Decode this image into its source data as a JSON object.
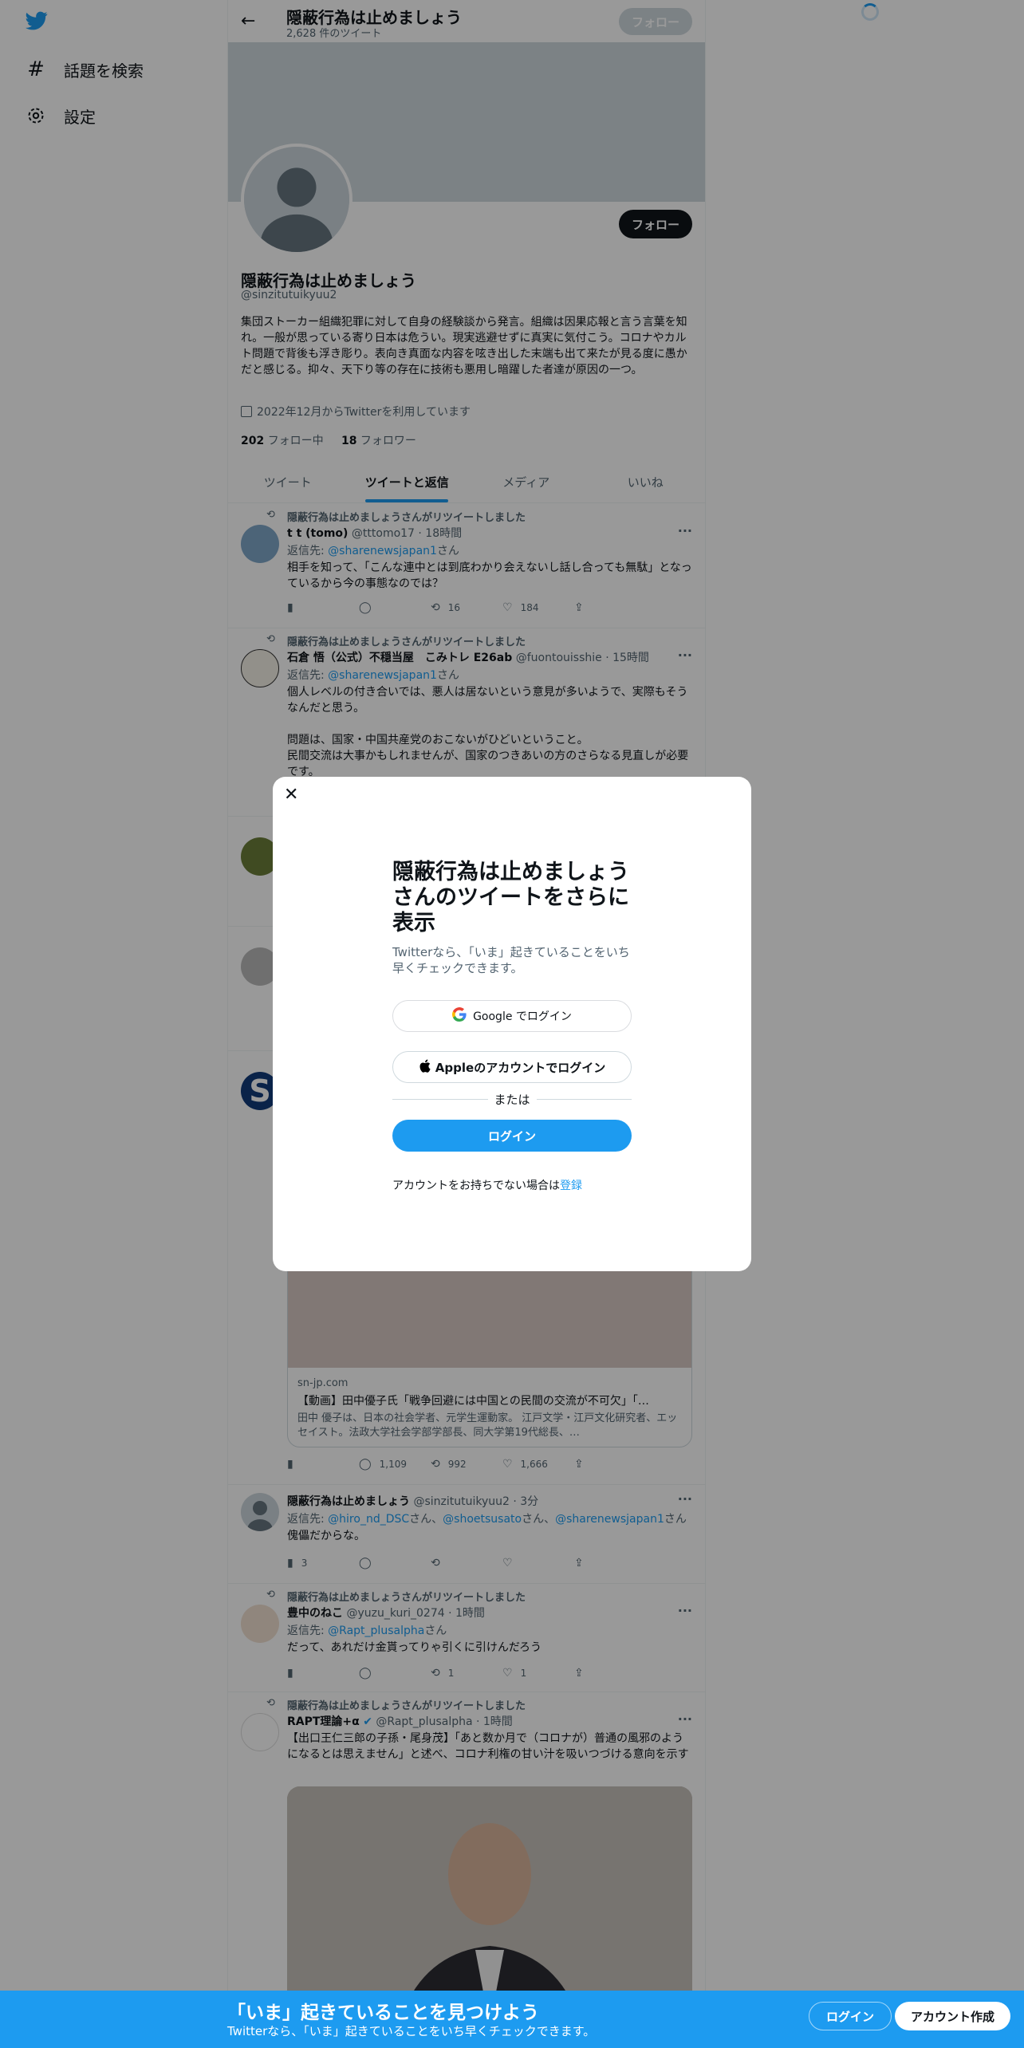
{
  "nav": {
    "explore_label": "話題を検索",
    "settings_label": "設定"
  },
  "header": {
    "name": "隠蔽行為は止めましょう",
    "tweet_count": "2,628 件のツイート",
    "follow_label": "フォロー"
  },
  "profile": {
    "follow_label": "フォロー",
    "name": "隠蔽行為は止めましょう",
    "handle": "@sinzitutuikyuu2",
    "bio": "集団ストーカー組織犯罪に対して自身の経験談から発言。組織は因果応報と言う言葉を知れ。一般が思っている寄り日本は危うい。現実逃避せずに真実に気付こう。コロナやカルト問題で背後も浮き彫り。表向き真面な内容を呟き出した末端も出て来たが見る度に愚かだと感じる。抑々、天下り等の存在に技術も悪用し暗躍した者達が原因の一つ。",
    "joined": "2022年12月からTwitterを利用しています",
    "following_count": "202",
    "following_label": "フォロー中",
    "followers_count": "18",
    "followers_label": "フォロワー"
  },
  "tabs": [
    {
      "label": "ツイート"
    },
    {
      "label": "ツイートと返信"
    },
    {
      "label": "メディア"
    },
    {
      "label": "いいね"
    }
  ],
  "tweets": [
    {
      "retweet_line": "隠蔽行為は止めましょうさんがリツイートしました",
      "name": "t t (tomo)",
      "meta": "@tttomo17 · 18時間",
      "reply_prefix": "返信先: ",
      "reply_to": "@sharenewsjapan1",
      "reply_suffix": "さん",
      "text": "相手を知って、「こんな連中とは到底わかり会えないし話し合っても無駄」となっているから今の事態なのでは？",
      "views": "",
      "replies": "",
      "retweets": "16",
      "likes": "184"
    },
    {
      "retweet_line": "隠蔽行為は止めましょうさんがリツイートしました",
      "name": "石倉 悟（公式）不穏当屋　こみトレ E26ab",
      "meta": "@fuontouisshie · 15時間",
      "reply_prefix": "返信先: ",
      "reply_to": "@sharenewsjapan1",
      "reply_suffix": "さん",
      "text": "個人レベルの付き合いでは、悪人は居ないという意見が多いようで、実際もそうなんだと思う。\n\n問題は、国家・中国共産党のおこないがひどいということ。\n民間交流は大事かもしれませんが、国家のつきあいの方のさらなる見直しが必要です。"
    },
    {
      "card_domain": "sn-jp.com",
      "card_title": "【動画】田中優子氏「戦争回避には中国との民間の交流が不可欠」「…",
      "card_desc": "田中 優子は、日本の社会学者、元学生運動家。 江戸文学・江戸文化研究者、エッセイスト。法政大学社会学部学部長、同大学第19代総長、…",
      "views": "",
      "replies": "1,109",
      "retweets": "992",
      "likes": "1,666"
    },
    {
      "name": "隠蔽行為は止めましょう",
      "meta": "@sinzitutuikyuu2 · 3分",
      "reply_prefix": "返信先: ",
      "reply_to_list": [
        "@hiro_nd_DSC",
        "@shoetsusato",
        "@sharenewsjapan1"
      ],
      "reply_joiner": "さん、",
      "reply_suffix": "さん",
      "text": "傀儡だからな。",
      "views": "3",
      "replies": "",
      "retweets": "",
      "likes": ""
    },
    {
      "retweet_line": "隠蔽行為は止めましょうさんがリツイートしました",
      "name": "豊中のねこ",
      "meta": "@yuzu_kuri_0274 · 1時間",
      "reply_prefix": "返信先: ",
      "reply_to": "@Rapt_plusalpha",
      "reply_suffix": "さん",
      "text": "だって、あれだけ金貰ってりゃ引くに引けんだろう",
      "views": "",
      "replies": "",
      "retweets": "1",
      "likes": "1"
    },
    {
      "retweet_line": "隠蔽行為は止めましょうさんがリツイートしました",
      "name": "RAPT理論+α",
      "meta": "@Rapt_plusalpha · 1時間",
      "text": "【出口王仁三郎の子孫・尾身茂】「あと数か月で（コロナが）普通の風邪のようになるとは思えません」と述べ、コロナ利権の甘い汁を吸いつづける意向を示す"
    }
  ],
  "modal": {
    "title": "隠蔽行為は止めましょうさんのツイートをさらに表示",
    "subtitle": "Twitterなら、「いま」起きていることをいち早くチェックできます。",
    "google_label": "Google でログイン",
    "apple_label": "Appleのアカウントでログイン",
    "or_label": "または",
    "login_label": "ログイン",
    "signup_prefix": "アカウントをお持ちでない場合は",
    "signup_link": "登録"
  },
  "bottom": {
    "title": "「いま」起きていることを見つけよう",
    "subtitle": "Twitterなら、「いま」起きていることをいち早くチェックできます。",
    "login_label": "ログイン",
    "signup_label": "アカウント作成"
  },
  "colors": {
    "accent": "#1d9bf0",
    "text": "#0f1419",
    "secondary": "#536471"
  }
}
